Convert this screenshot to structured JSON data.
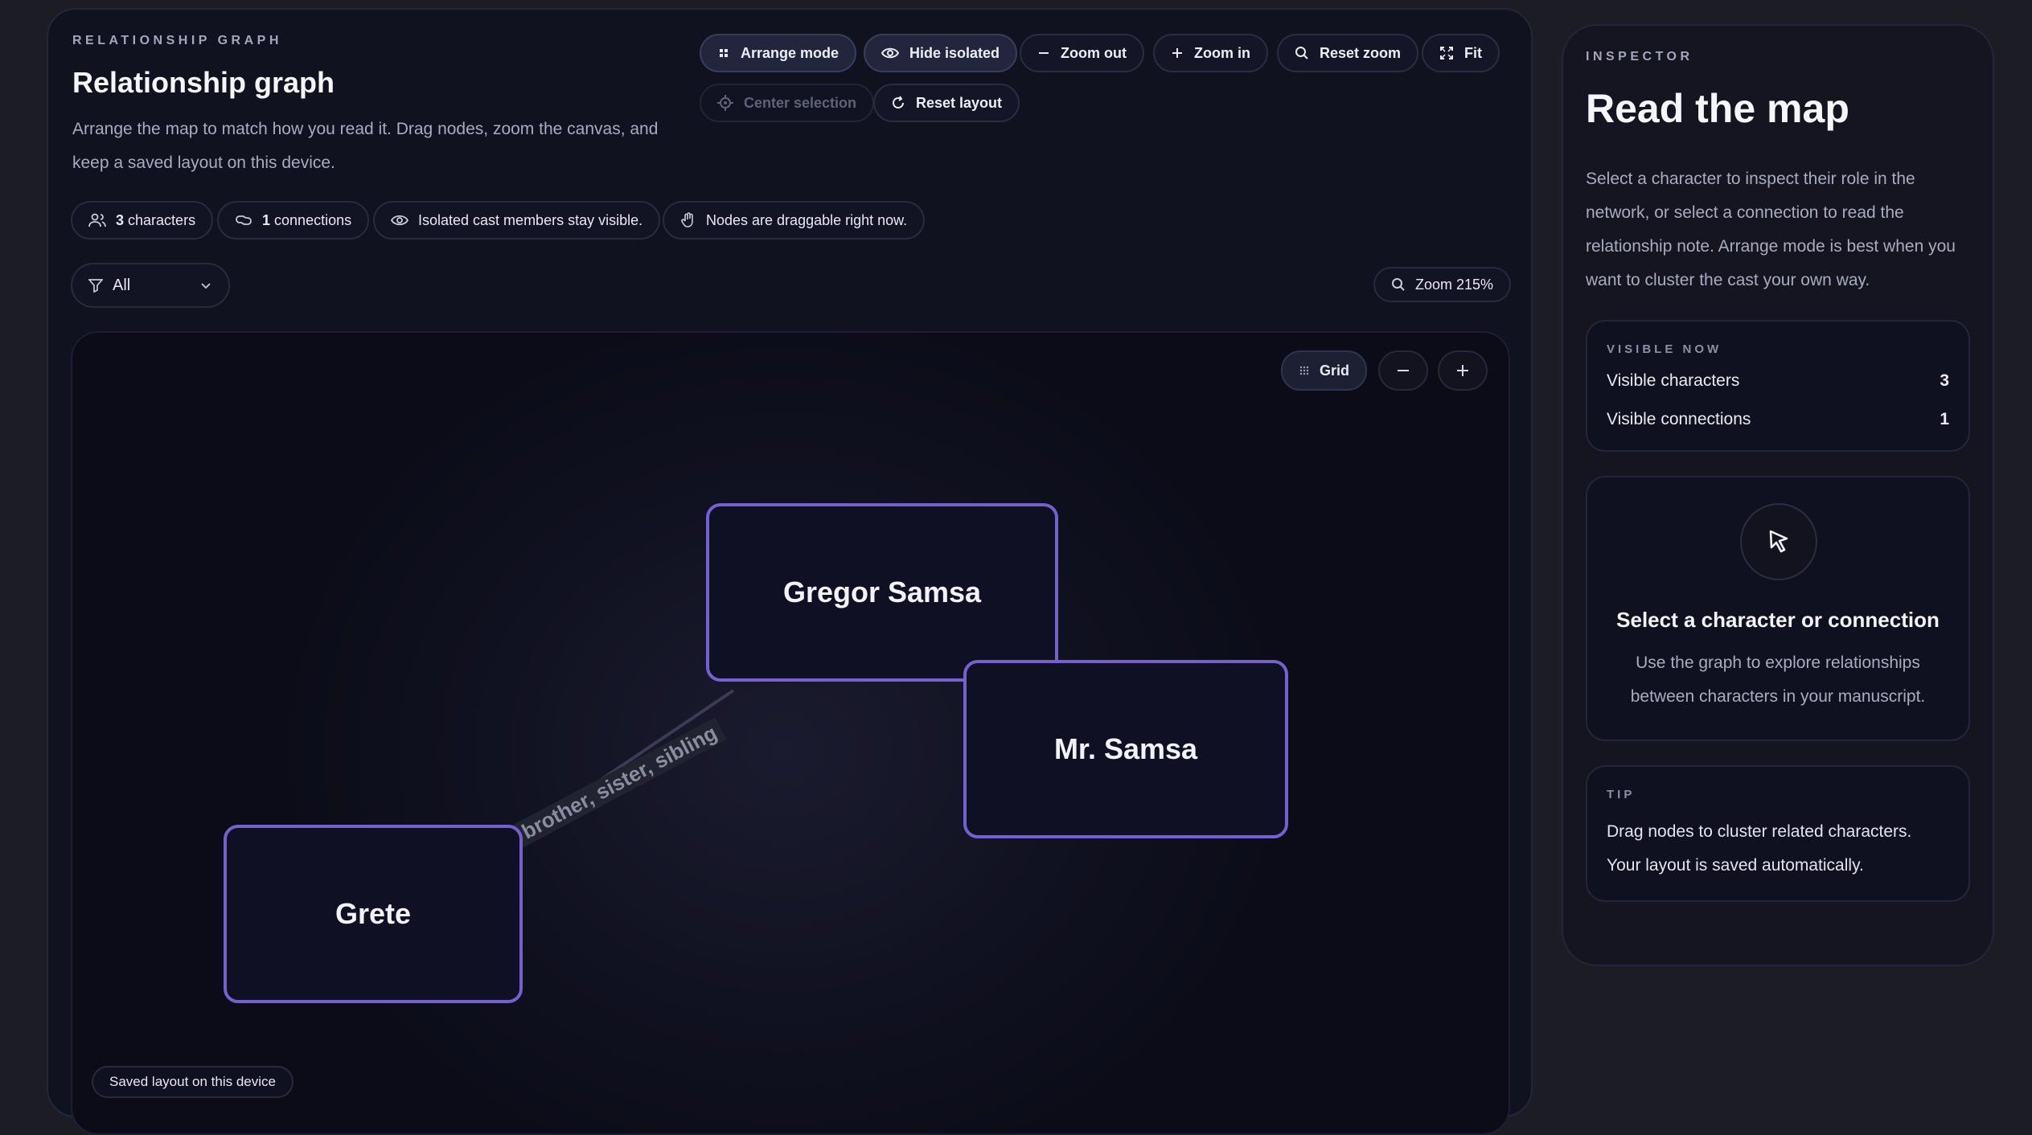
{
  "header": {
    "eyebrow": "RELATIONSHIP GRAPH",
    "title": "Relationship graph",
    "description": "Arrange the map to match how you read it. Drag nodes, zoom the canvas, and keep a saved layout on this device."
  },
  "toolbar": {
    "arrange_mode": "Arrange mode",
    "hide_isolated": "Hide isolated",
    "zoom_out": "Zoom out",
    "zoom_in": "Zoom in",
    "reset_zoom": "Reset zoom",
    "fit": "Fit",
    "center_selection": "Center selection",
    "reset_layout": "Reset layout"
  },
  "stats": {
    "characters_count": "3",
    "characters_label": "characters",
    "connections_count": "1",
    "connections_label": "connections",
    "isolated_note": "Isolated cast members stay visible.",
    "draggable_note": "Nodes are draggable right now."
  },
  "filter": {
    "selected": "All"
  },
  "zoom": {
    "label": "Zoom 215%"
  },
  "canvas": {
    "grid_label": "Grid",
    "saved_note": "Saved layout on this device",
    "nodes": [
      {
        "label": "Gregor Samsa"
      },
      {
        "label": "Mr. Samsa"
      },
      {
        "label": "Grete"
      }
    ],
    "edge_label": "brother, sister, sibling"
  },
  "inspector": {
    "eyebrow": "INSPECTOR",
    "title": "Read the map",
    "description": "Select a character to inspect their role in the network, or select a connection to read the relationship note. Arrange mode is best when you want to cluster the cast your own way.",
    "visible_now": {
      "eyebrow": "VISIBLE NOW",
      "characters_label": "Visible characters",
      "characters_value": "3",
      "connections_label": "Visible connections",
      "connections_value": "1"
    },
    "empty": {
      "title": "Select a character or connection",
      "text": "Use the graph to explore relationships between characters in your manuscript."
    },
    "tip": {
      "eyebrow": "TIP",
      "text": "Drag nodes to cluster related characters. Your layout is saved automatically."
    }
  },
  "colors": {
    "accent": "#7461cf",
    "background": "#1c1d24",
    "panel": "#111220"
  }
}
